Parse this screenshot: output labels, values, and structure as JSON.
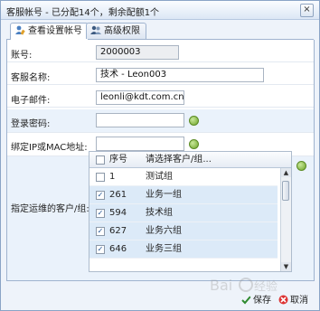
{
  "dialog": {
    "title": "客服帐号 - 已分配14个，剩余配额1个",
    "close_glyph": "×"
  },
  "tabs": [
    {
      "label": "查看设置帐号",
      "icon": "user-edit-icon"
    },
    {
      "label": "高级权限",
      "icon": "users-icon"
    }
  ],
  "form": {
    "account": {
      "label": "账号:",
      "value": "2000003"
    },
    "cs_name": {
      "label": "客服名称:",
      "value": "技术 - Leon003"
    },
    "email": {
      "label": "电子邮件:",
      "value": "leonli@kdt.com.cn"
    },
    "password": {
      "label": "登录密码:",
      "value": ""
    },
    "bind": {
      "label": "绑定IP或MAC地址:",
      "value": ""
    },
    "groups": {
      "label": "指定运维的客户/组:"
    }
  },
  "grid": {
    "headers": {
      "seq": "序号",
      "name": "请选择客户/组..."
    },
    "rows": [
      {
        "id": "1",
        "name": "测试组",
        "checked": false
      },
      {
        "id": "261",
        "name": "业务一组",
        "checked": true
      },
      {
        "id": "594",
        "name": "技术组",
        "checked": true
      },
      {
        "id": "627",
        "name": "业务六组",
        "checked": true
      },
      {
        "id": "646",
        "name": "业务三组",
        "checked": true
      }
    ]
  },
  "footer": {
    "save": "保存",
    "cancel": "取消"
  },
  "colors": {
    "accent": "#4a7fc1",
    "help": "#6ea42a",
    "selected_row": "#dceaf8"
  }
}
